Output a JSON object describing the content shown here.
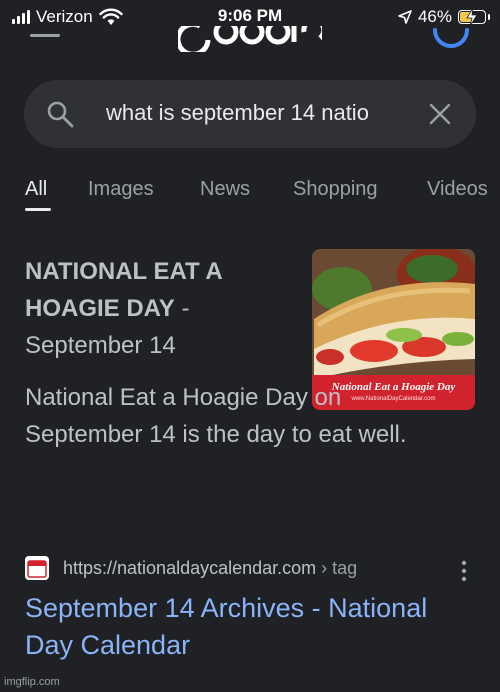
{
  "status_bar": {
    "carrier": "Verizon",
    "time": "9:06 PM",
    "battery": "46%"
  },
  "search": {
    "query": "what is september 14 natio"
  },
  "tabs": [
    {
      "label": "All",
      "active": true
    },
    {
      "label": "Images"
    },
    {
      "label": "News"
    },
    {
      "label": "Shopping"
    },
    {
      "label": "Videos"
    }
  ],
  "snippet": {
    "title_bold": "NATIONAL EAT A HOAGIE DAY",
    "title_dash": " -",
    "title_date": "September 14",
    "text": "National Eat a Hoagie Day on September 14 is the day to eat well.",
    "image": {
      "caption": "National Eat a Hoagie Day",
      "site": "www.NationalDayCalendar.com"
    }
  },
  "result": {
    "url": "https://nationaldaycalendar.com",
    "path": " › tag",
    "title": "September 14 Archives - National Day Calendar"
  },
  "watermark": "imgflip.com",
  "colors": {
    "background": "#202124",
    "search_bg": "#303134",
    "link": "#8ab4f8",
    "text": "#bdc1c6"
  }
}
